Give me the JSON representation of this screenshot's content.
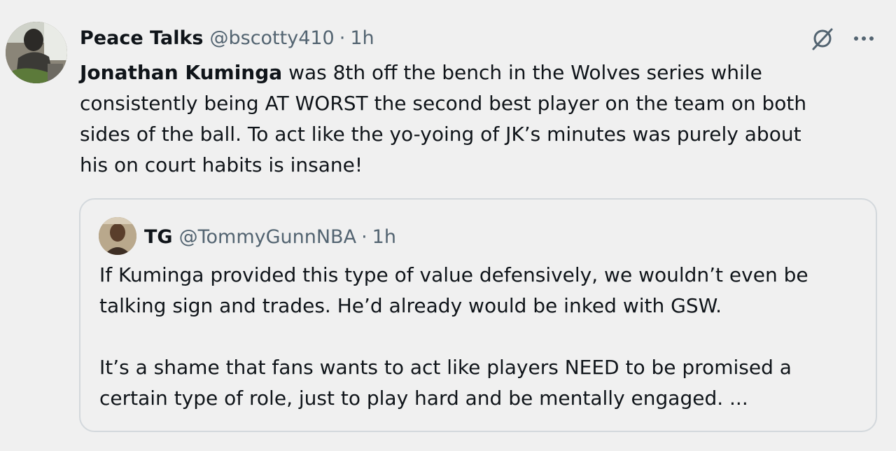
{
  "tweet": {
    "author": {
      "name": "Peace Talks",
      "handle": "@bscotty410",
      "separator": "·",
      "time": "1h"
    },
    "text_lines": [
      {
        "bold": "Jonathan Kuminga",
        "rest": " was 8th off the bench in the Wolves series while"
      },
      {
        "bold": "",
        "rest": "consistently being AT WORST the second best player on the team on both"
      },
      {
        "bold": "",
        "rest": "sides of the ball. To act like the yo-yoing of JK’s minutes was purely about"
      },
      {
        "bold": "",
        "rest": "his on court habits is insane!"
      }
    ],
    "icons": {
      "grok": "grok-icon",
      "more": "more-dots-icon",
      "avatar": "avatar-photo"
    },
    "colors": {
      "background": "#f0f0f0",
      "text": "#0f1419",
      "muted": "#536471",
      "border": "#d3d8dc"
    }
  },
  "quote": {
    "author": {
      "name": "TG",
      "handle": "@TommyGunnNBA",
      "separator": "·",
      "time": "1h"
    },
    "paragraphs": [
      [
        "If Kuminga provided this type of value defensively, we wouldn’t even be",
        "talking sign and trades. He’d already would be inked with GSW."
      ],
      [
        "It’s a shame that fans wants to act like players NEED to be promised a",
        "certain type of role, just to play hard and be mentally engaged. ..."
      ]
    ]
  }
}
